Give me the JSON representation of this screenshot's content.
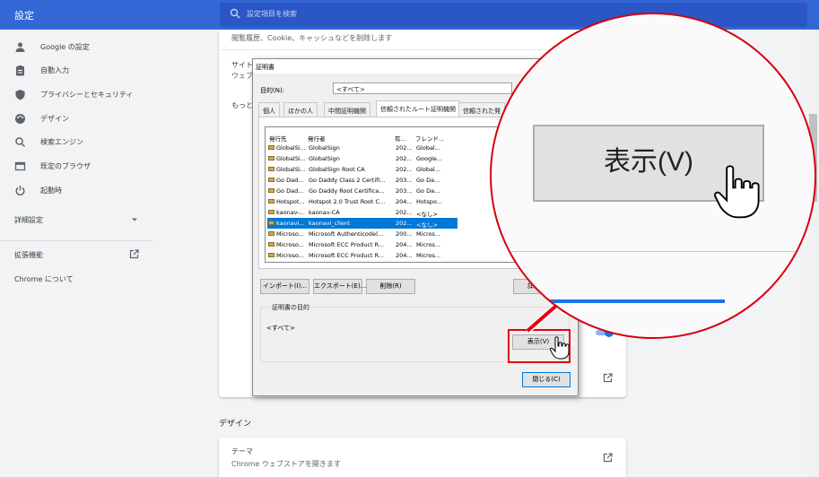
{
  "header": {
    "app_title": "設定",
    "search_placeholder": "設定項目を検索"
  },
  "sidebar": {
    "items": [
      {
        "label": "Google の設定",
        "icon": "person-icon"
      },
      {
        "label": "自動入力",
        "icon": "clipboard-icon"
      },
      {
        "label": "プライバシーとセキュリティ",
        "icon": "shield-icon"
      },
      {
        "label": "デザイン",
        "icon": "palette-icon"
      },
      {
        "label": "検索エンジン",
        "icon": "search-icon"
      },
      {
        "label": "既定のブラウザ",
        "icon": "browser-icon"
      },
      {
        "label": "起動時",
        "icon": "power-icon"
      }
    ],
    "advanced_label": "詳細設定",
    "extensions_label": "拡張機能",
    "about_label": "Chrome について"
  },
  "privacy_card": {
    "clear_desc": "閲覧履歴、Cookie、キャッシュなどを削除します",
    "site_label": "サイト",
    "site_desc": "ウェブ",
    "more_label": "もっと"
  },
  "design_section": {
    "heading": "デザイン",
    "theme_label": "テーマ",
    "theme_desc": "Chrome ウェブストアを開きます"
  },
  "cert_dialog": {
    "title": "証明書",
    "purpose_label": "目的(N):",
    "purpose_value": "<すべて>",
    "tabs": [
      "個人",
      "ほかの人",
      "中間証明機関",
      "信頼されたルート証明機関",
      "信頼された発"
    ],
    "selected_tab": 3,
    "columns": [
      "発行先",
      "発行者",
      "有...",
      "フレンド..."
    ],
    "rows": [
      {
        "to": "GlobalSi...",
        "by": "GlobalSign",
        "exp": "202...",
        "name": "Global..."
      },
      {
        "to": "GlobalSi...",
        "by": "GlobalSign",
        "exp": "202...",
        "name": "Google..."
      },
      {
        "to": "GlobalSi...",
        "by": "GlobalSign Root CA",
        "exp": "202...",
        "name": "Global..."
      },
      {
        "to": "Go Dad...",
        "by": "Go Daddy Class 2 Certifi...",
        "exp": "203...",
        "name": "Go Da..."
      },
      {
        "to": "Go Dad...",
        "by": "Go Daddy Root Certifica...",
        "exp": "203...",
        "name": "Go Da..."
      },
      {
        "to": "Hotspot...",
        "by": "Hotspot 2.0 Trust Root C...",
        "exp": "204...",
        "name": "Hotspo..."
      },
      {
        "to": "kaonav-...",
        "by": "kaonav-CA",
        "exp": "202...",
        "name": "<なし>"
      },
      {
        "to": "kaonavi...",
        "by": "kaonavi_client",
        "exp": "202...",
        "name": "<なし>"
      },
      {
        "to": "Microso...",
        "by": "Microsoft Authenticode(...",
        "exp": "200...",
        "name": "Micros..."
      },
      {
        "to": "Microso...",
        "by": "Microsoft ECC Product R...",
        "exp": "204...",
        "name": "Micros..."
      },
      {
        "to": "Microso...",
        "by": "Microsoft ECC Product R...",
        "exp": "204...",
        "name": "Micros..."
      }
    ],
    "selected_row": 7,
    "import_label": "インポート(I)...",
    "export_label": "エクスポート(E)...",
    "remove_label": "削除(R)",
    "advanced_label": "詳細設定",
    "group_title": "証明書の目的",
    "group_value": "<すべて>",
    "view_label": "表示(V)",
    "close_label": "閉じる(C)"
  },
  "magnifier": {
    "label": "表示(V)"
  },
  "colors": {
    "header": "#3367d6",
    "highlight": "#e60012",
    "selection": "#0078d7"
  }
}
